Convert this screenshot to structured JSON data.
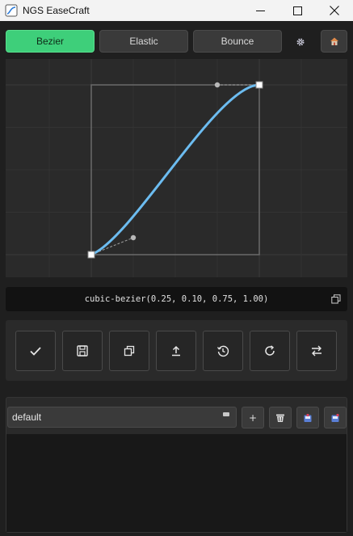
{
  "window": {
    "title": "NGS EaseCraft",
    "icon": "easecraft-app-icon",
    "controls": [
      "minimize-icon",
      "maximize-icon",
      "close-icon"
    ]
  },
  "tabs": [
    {
      "label": "Bezier",
      "active": true
    },
    {
      "label": "Elastic",
      "active": false
    },
    {
      "label": "Bounce",
      "active": false
    }
  ],
  "toolbar_icons": {
    "settings": "gear-icon",
    "home": "home-icon"
  },
  "curve": {
    "p1": [
      0.25,
      0.1
    ],
    "p2": [
      0.75,
      1.0
    ],
    "curve_color": "#6cbcf0",
    "handle_color": "#b8b8b8"
  },
  "output": {
    "css": "cubic-bezier(0.25, 0.10, 0.75, 1.00)",
    "copy_icon": "copy-icon"
  },
  "actions": [
    "apply-icon",
    "save-icon",
    "duplicate-icon",
    "export-icon",
    "history-icon",
    "reset-icon",
    "swap-icon"
  ],
  "presets": {
    "selected": "default",
    "add_label": "+",
    "buttons": [
      "add-icon",
      "delete-icon",
      "import-icon",
      "export-icon"
    ]
  },
  "colors": {
    "accent": "#3ecf7a",
    "background": "#1f1f1f",
    "panel": "#2a2a2a"
  }
}
